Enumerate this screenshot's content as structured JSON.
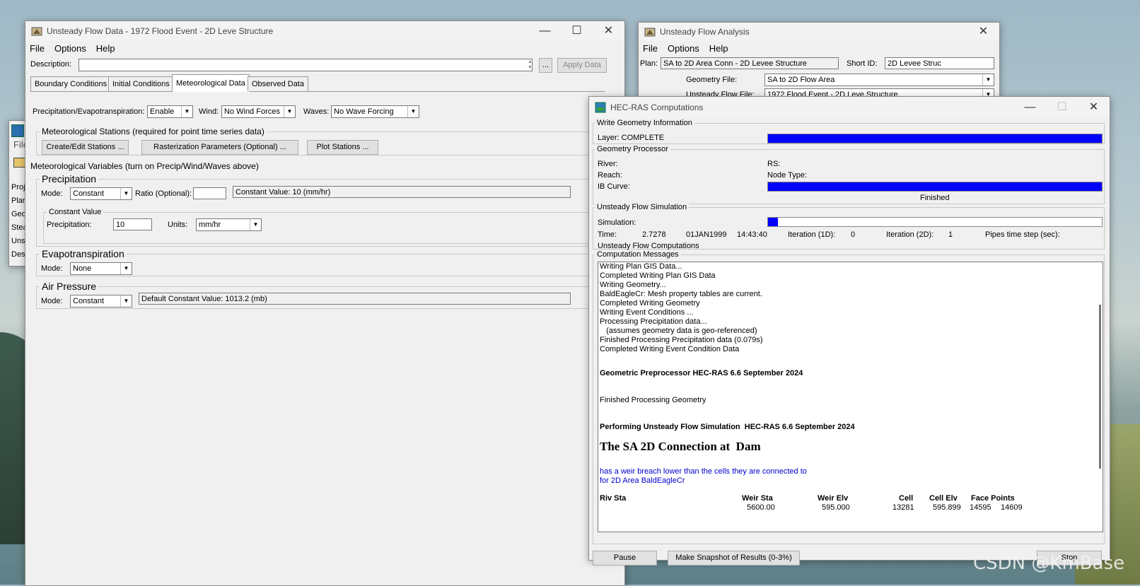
{
  "ufd": {
    "title": "Unsteady Flow Data - 1972 Flood Event - 2D Leve Structure",
    "menu": [
      "File",
      "Options",
      "Help"
    ],
    "description_label": "Description:",
    "description_value": "",
    "browse_label": "...",
    "apply_label": "Apply Data",
    "tabs": [
      "Boundary Conditions",
      "Initial Conditions",
      "Meteorological Data",
      "Observed Data"
    ],
    "precip_evap_label": "Precipitation/Evapotranspiration:",
    "precip_evap_value": "Enable",
    "wind_label": "Wind:",
    "wind_value": "No Wind Forces",
    "waves_label": "Waves:",
    "waves_value": "No Wave Forcing",
    "met_stations_title": "Meteorological Stations (required for point time series data)",
    "create_stations": "Create/Edit Stations ...",
    "rasterization": "Rasterization Parameters (Optional) ...",
    "plot_stations": "Plot Stations ...",
    "met_vars_title": "Meteorological Variables (turn on Precip/Wind/Waves above)",
    "precip_title": "Precipitation",
    "mode_label": "Mode:",
    "precip_mode": "Constant",
    "ratio_label": "Ratio (Optional):",
    "ratio_value": "",
    "constant_value_text": "Constant Value: 10 (mm/hr)",
    "constant_value_title": "Constant Value",
    "precipitation_label": "Precipitation:",
    "precipitation_value": "10",
    "units_label": "Units:",
    "units_value": "mm/hr",
    "evap_title": "Evapotranspiration",
    "evap_mode": "None",
    "air_title": "Air Pressure",
    "air_mode": "Constant",
    "air_default": "Default Constant Value: 1013.2 (mb)"
  },
  "ufa": {
    "title": "Unsteady Flow Analysis",
    "menu": [
      "File",
      "Options",
      "Help"
    ],
    "plan_label": "Plan:",
    "plan_value": "SA to 2D Area Conn - 2D Levee Structure",
    "short_id_label": "Short ID:",
    "short_id_value": "2D Levee Struc",
    "geometry_label": "Geometry File:",
    "geometry_value": "SA to 2D Flow Area",
    "unsteady_label": "Unsteady Flow File:",
    "unsteady_value": "1972 Flood Event - 2D Leve Structure"
  },
  "ras_main": {
    "menu_fragment": "File",
    "side_items": [
      "Proj",
      "Plan",
      "Geo",
      "Stea",
      "Unst",
      "Desc"
    ]
  },
  "comp": {
    "title": "HEC-RAS Computations",
    "write_geom_title": "Write Geometry Information",
    "layer_text": "Layer:  COMPLETE",
    "write_geom_progress": 1.0,
    "geom_proc_title": "Geometry Processor",
    "river_label": "River:",
    "rs_label": "RS:",
    "reach_label": "Reach:",
    "node_type_label": "Node Type:",
    "ib_curve_label": "IB Curve:",
    "ib_progress": 1.0,
    "finished_label": "Finished",
    "usf_title": "Unsteady Flow Simulation",
    "simulation_label": "Simulation:",
    "sim_progress": 0.03,
    "time_label": "Time:",
    "time_value": "2.7278",
    "date_value": "01JAN1999",
    "clock_value": "14:43:40",
    "iter1d_label": "Iteration (1D):",
    "iter1d_value": "0",
    "iter2d_label": "Iteration (2D):",
    "iter2d_value": "1",
    "pipes_label": "Pipes time step (sec):",
    "status_text": "Unsteady Flow Computations",
    "messages_title": "Computation Messages",
    "messages": [
      {
        "text": "Writing Plan GIS Data...",
        "style": "normal"
      },
      {
        "text": "Completed Writing Plan GIS Data",
        "style": "normal"
      },
      {
        "text": "Writing Geometry...",
        "style": "normal"
      },
      {
        "text": "BaldEagleCr: Mesh property tables are current.",
        "style": "normal"
      },
      {
        "text": "Completed Writing Geometry",
        "style": "normal"
      },
      {
        "text": "Writing Event Conditions ...",
        "style": "normal"
      },
      {
        "text": "Processing Precipitation data...",
        "style": "normal"
      },
      {
        "text": "   (assumes geometry data is geo-referenced)",
        "style": "normal"
      },
      {
        "text": "Finished Processing Precipitation data (0.079s)",
        "style": "normal"
      },
      {
        "text": "Completed Writing Event Condition Data",
        "style": "normal"
      },
      {
        "text": "Geometric Preprocessor HEC-RAS 6.6 September 2024",
        "style": "bold"
      },
      {
        "text": "Finished Processing Geometry",
        "style": "normal"
      },
      {
        "text": "Performing Unsteady Flow Simulation  HEC-RAS 6.6 September 2024",
        "style": "bold"
      },
      {
        "text": "The SA 2D Connection at  Dam",
        "style": "big"
      },
      {
        "text": "has a weir breach lower than the cells they are connected to",
        "style": "blue"
      },
      {
        "text": "for 2D Area BaldEagleCr",
        "style": "blue"
      }
    ],
    "table_headers": [
      "Riv Sta",
      "Weir Sta",
      "Weir Elv",
      "Cell",
      "Cell Elv",
      "Face Points"
    ],
    "table_row": [
      "",
      "5600.00",
      "595.000",
      "13281",
      "595.899",
      "14595",
      "14609"
    ],
    "pause_label": "Pause",
    "snapshot_label": "Make Snapshot of Results (0-3%)",
    "stop_label": "Stop"
  },
  "watermark": "CSDN @KmBase",
  "colors": {
    "progress": "#0000ff",
    "message_blue": "#0000cc"
  }
}
